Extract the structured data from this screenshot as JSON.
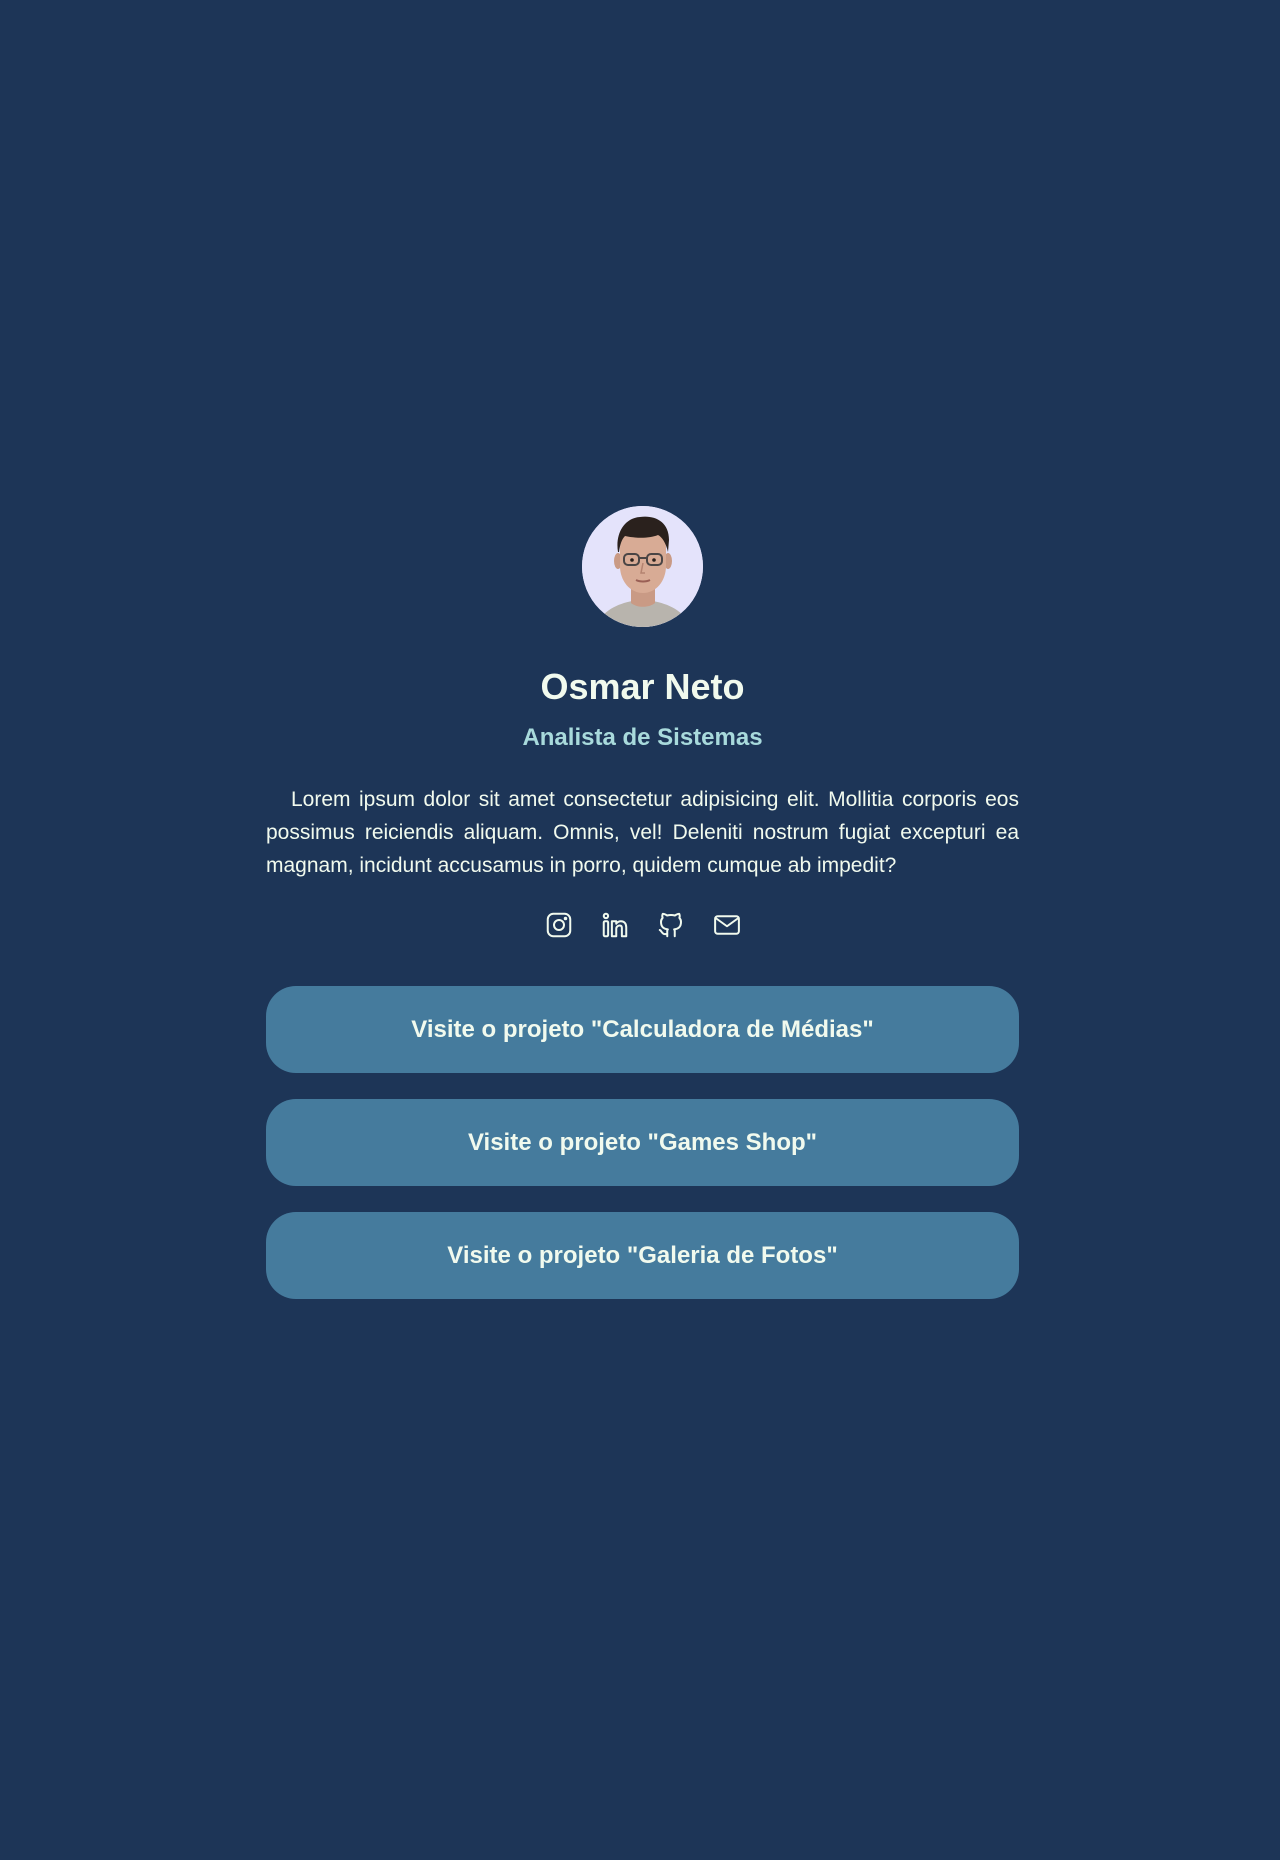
{
  "profile": {
    "avatar_alt": "Osmar Neto",
    "name": "Osmar Neto",
    "role": "Analista de Sistemas",
    "bio": "Lorem ipsum dolor sit amet consectetur adipisicing elit. Mollitia corporis eos possimus reiciendis aliquam. Omnis, vel! Deleniti nostrum fugiat excepturi ea magnam, incidunt accusamus in porro, quidem cumque ab impedit?"
  },
  "social": [
    {
      "icon": "instagram-icon"
    },
    {
      "icon": "linkedin-icon"
    },
    {
      "icon": "github-icon"
    },
    {
      "icon": "mail-icon"
    }
  ],
  "links": [
    {
      "label": "Visite o projeto \"Calculadora de Médias\""
    },
    {
      "label": "Visite o projeto \"Games Shop\""
    },
    {
      "label": "Visite o projeto \"Galeria de Fotos\""
    }
  ],
  "colors": {
    "background": "#1d3557",
    "text": "#f1faee",
    "accent": "#a8dadc",
    "button": "#457b9d",
    "avatar_background": "#e4e3fb"
  }
}
